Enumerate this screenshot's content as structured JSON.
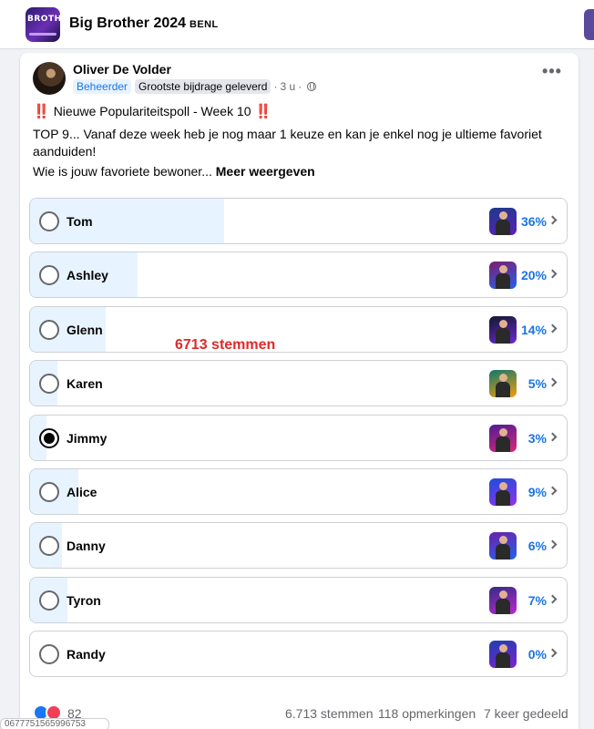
{
  "group": {
    "title": "Big Brother 2024",
    "suffix": "BENL",
    "thumb_text": "BROTHE"
  },
  "post": {
    "author": "Oliver De Volder",
    "badge_admin": "Beheerder",
    "badge_contributor": "Grootste bijdrage geleverd",
    "time": "3 u",
    "more_icon": "more-horizontal-icon",
    "title_text": "Nieuwe Populariteitspoll - Week 10",
    "emoji": "‼️",
    "body": "TOP 9... Vanaf deze week heb je nog maar 1 keuze en kan je enkel nog je ultieme favoriet aanduiden!",
    "question": "Wie is  jouw favoriete bewoner...",
    "see_more": "Meer weergeven"
  },
  "poll": {
    "selected": "Jimmy",
    "options": [
      {
        "label": "Tom",
        "percent_label": "36%",
        "fraction": 0.36
      },
      {
        "label": "Ashley",
        "percent_label": "20%",
        "fraction": 0.2
      },
      {
        "label": "Glenn",
        "percent_label": "14%",
        "fraction": 0.14
      },
      {
        "label": "Karen",
        "percent_label": "5%",
        "fraction": 0.05
      },
      {
        "label": "Jimmy",
        "percent_label": "3%",
        "fraction": 0.03
      },
      {
        "label": "Alice",
        "percent_label": "9%",
        "fraction": 0.09
      },
      {
        "label": "Danny",
        "percent_label": "6%",
        "fraction": 0.06
      },
      {
        "label": "Tyron",
        "percent_label": "7%",
        "fraction": 0.07
      },
      {
        "label": "Randy",
        "percent_label": "0%",
        "fraction": 0.0
      }
    ]
  },
  "annotation": "6713 stemmen",
  "footer": {
    "reactions_count": "82",
    "votes": "6.713 stemmen",
    "comments": "118 opmerkingen",
    "shares": "7 keer gedeeld"
  },
  "tooltip_text": "0677751565996753"
}
